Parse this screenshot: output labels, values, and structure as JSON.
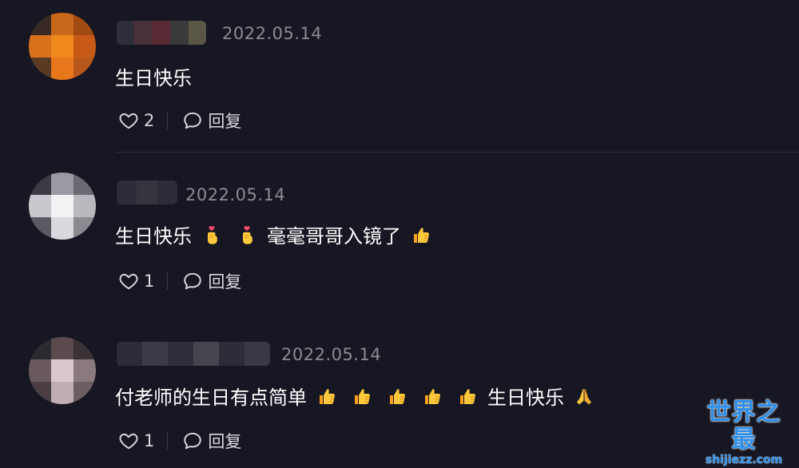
{
  "comments": [
    {
      "date": "2022.05.14",
      "text_parts": [
        "生日快乐"
      ],
      "likes": "2",
      "reply_label": "回复"
    },
    {
      "date": "2022.05.14",
      "text_parts": [
        "生日快乐",
        "毫毫哥哥入镜了"
      ],
      "likes": "1",
      "reply_label": "回复"
    },
    {
      "date": "2022.05.14",
      "text_parts": [
        "付老师的生日有点简单",
        "生日快乐"
      ],
      "likes": "1",
      "reply_label": "回复"
    }
  ],
  "icons": {
    "heart": "heart-icon",
    "reply": "speech-bubble-icon",
    "finger_heart": "finger-heart-emoji",
    "thumbs_up": "thumbs-up-emoji",
    "pray": "folded-hands-emoji"
  },
  "colors": {
    "background": "#161722",
    "date": "#8a8b93",
    "text": "#ffffff",
    "watermark": "#2f8fe8"
  },
  "watermark": {
    "title": "世界之最",
    "url": "shijiezz.com"
  }
}
